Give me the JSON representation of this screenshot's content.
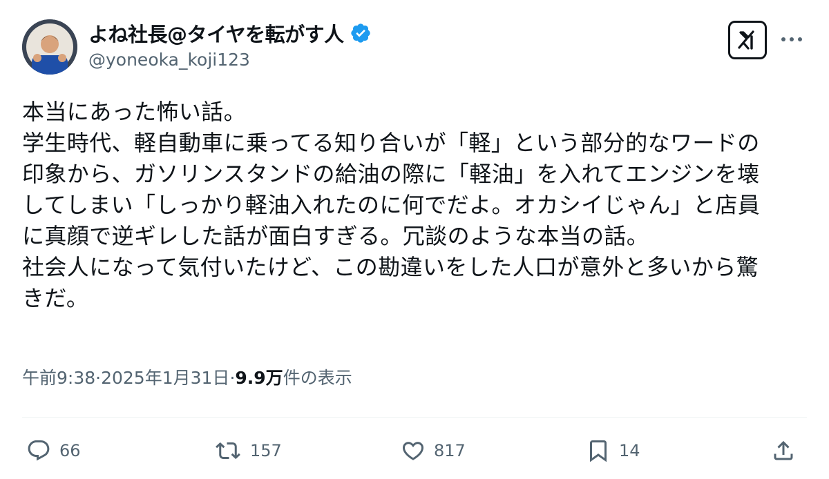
{
  "author": {
    "display_name": "よね社長@タイヤを転がす人",
    "handle": "@yoneoka_koji123",
    "verified": true,
    "verified_color": "#1d9bf0"
  },
  "header_actions": {
    "grok_icon": "grok-icon",
    "more_icon": "more-dots-icon"
  },
  "body_lines": [
    "本当にあった怖い話。",
    "学生時代、軽自動車に乗ってる知り合いが「軽」という部分的なワードの",
    "印象から、ガソリンスタンドの給油の際に「軽油」を入れてエンジンを壊",
    "してしまい「しっかり軽油入れたのに何でだよ。オカシイじゃん」と店員",
    "に真顔で逆ギレした話が面白すぎる。冗談のような本当の話。",
    "社会人になって気付いたけど、この勘違いをした人口が意外と多いから驚",
    "きだ。"
  ],
  "meta": {
    "time": "午前9:38",
    "separator": " · ",
    "date": "2025年1月31日",
    "views_count": "9.9万",
    "views_label": " 件の表示"
  },
  "actions": {
    "replies": "66",
    "reposts": "157",
    "likes": "817",
    "bookmarks": "14"
  },
  "colors": {
    "text": "#0f1419",
    "secondary": "#536471",
    "divider": "#eff3f4"
  }
}
